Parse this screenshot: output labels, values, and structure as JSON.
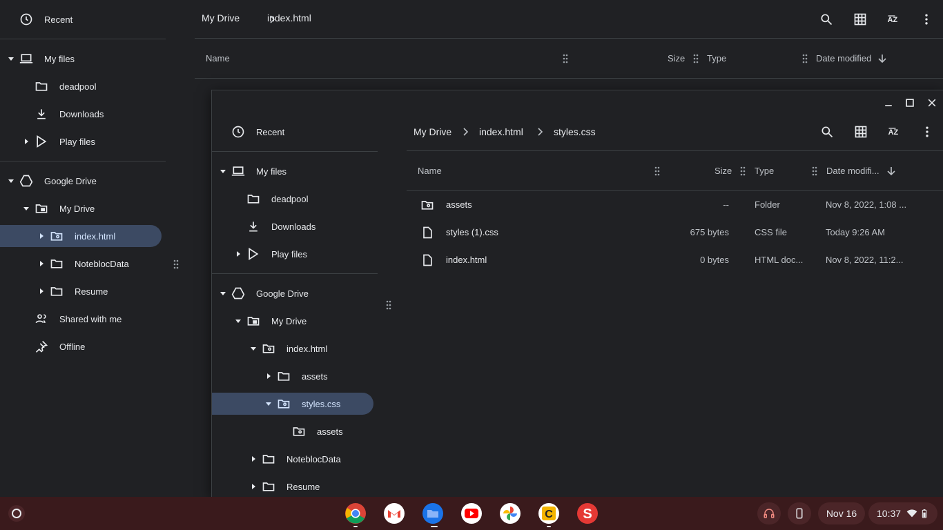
{
  "background_window": {
    "sidebar": {
      "recent": "Recent",
      "my_files": "My files",
      "deadpool": "deadpool",
      "downloads": "Downloads",
      "play_files": "Play files",
      "google_drive": "Google Drive",
      "my_drive": "My Drive",
      "index_html": "index.html",
      "notebloc": "NoteblocData",
      "resume": "Resume",
      "shared": "Shared with me",
      "offline": "Offline"
    },
    "breadcrumb": [
      "My Drive",
      "index.html"
    ],
    "columns": {
      "name": "Name",
      "size": "Size",
      "type": "Type",
      "date": "Date modified"
    }
  },
  "foreground_window": {
    "sidebar": {
      "recent": "Recent",
      "my_files": "My files",
      "deadpool": "deadpool",
      "downloads": "Downloads",
      "play_files": "Play files",
      "google_drive": "Google Drive",
      "my_drive": "My Drive",
      "index_html": "index.html",
      "assets": "assets",
      "styles_css": "styles.css",
      "assets_child": "assets",
      "notebloc": "NoteblocData",
      "resume": "Resume"
    },
    "breadcrumb": [
      "My Drive",
      "index.html",
      "styles.css"
    ],
    "columns": {
      "name": "Name",
      "size": "Size",
      "type": "Type",
      "date": "Date modifi..."
    },
    "files": [
      {
        "name": "assets",
        "size": "--",
        "type": "Folder",
        "date": "Nov 8, 2022, 1:08 ...",
        "icon": "shared-folder-icon"
      },
      {
        "name": "styles (1).css",
        "size": "675 bytes",
        "type": "CSS file",
        "date": "Today 9:26 AM",
        "icon": "file-icon"
      },
      {
        "name": "index.html",
        "size": "0 bytes",
        "type": "HTML doc...",
        "date": "Nov 8, 2022, 11:2...",
        "icon": "file-icon"
      }
    ]
  },
  "shelf": {
    "apps": [
      "Chrome",
      "Gmail",
      "Files",
      "YouTube",
      "Photos",
      "C",
      "S"
    ],
    "date": "Nov 16",
    "time": "10:37"
  },
  "colors": {
    "selected": "#3c4a63",
    "shelf": "#3a1a1c",
    "bg": "#202124"
  }
}
